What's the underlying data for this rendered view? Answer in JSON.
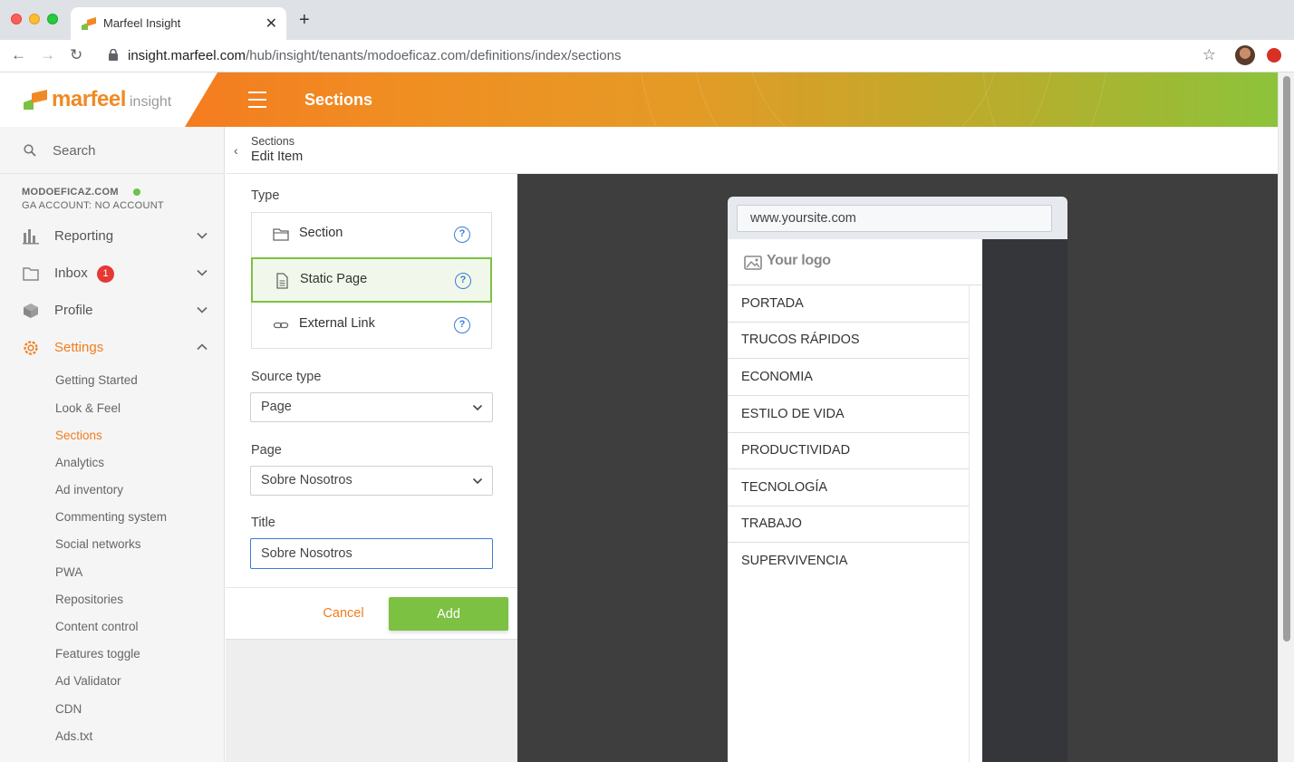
{
  "browser": {
    "tab_title": "Marfeel Insight",
    "url_domain": "insight.marfeel.com",
    "url_path": "/hub/insight/tenants/modoeficaz.com/definitions/index/sections"
  },
  "header": {
    "logo_text": "marfeel",
    "logo_sub": "insight",
    "title": "Sections"
  },
  "sidebar": {
    "search_placeholder": "Search",
    "account_name": "MODOEFICAZ.COM",
    "account_sub": "GA ACCOUNT: NO ACCOUNT",
    "nav": [
      {
        "label": "Reporting",
        "icon": "bar-chart-icon"
      },
      {
        "label": "Inbox",
        "icon": "folder-icon",
        "badge": "1"
      },
      {
        "label": "Profile",
        "icon": "cube-icon"
      },
      {
        "label": "Settings",
        "icon": "gear-icon"
      }
    ],
    "settings_items": [
      "Getting Started",
      "Look & Feel",
      "Sections",
      "Analytics",
      "Ad inventory",
      "Commenting system",
      "Social networks",
      "PWA",
      "Repositories",
      "Content control",
      "Features toggle",
      "Ad Validator",
      "CDN",
      "Ads.txt"
    ],
    "active_item": "Sections"
  },
  "breadcrumb": {
    "parent": "Sections",
    "current": "Edit Item"
  },
  "form": {
    "type_label": "Type",
    "types": [
      {
        "label": "Section",
        "icon": "folder-icon",
        "help": "?"
      },
      {
        "label": "Static Page",
        "icon": "document-icon",
        "help": "?"
      },
      {
        "label": "External Link",
        "icon": "link-icon",
        "help": "?"
      }
    ],
    "selected_type": "Static Page",
    "source_type_label": "Source type",
    "source_type_value": "Page",
    "page_label": "Page",
    "page_value": "Sobre Nosotros",
    "title_label": "Title",
    "title_value": "Sobre Nosotros",
    "cancel_label": "Cancel",
    "add_label": "Add"
  },
  "preview": {
    "url": "www.yoursite.com",
    "logo": "Your logo",
    "menu": [
      "PORTADA",
      "TRUCOS RÁPIDOS",
      "ECONOMIA",
      "ESTILO DE VIDA",
      "PRODUCTIVIDAD",
      "TECNOLOGÍA",
      "TRABAJO",
      "SUPERVIVENCIA"
    ]
  },
  "colors": {
    "brand_orange": "#f07d1e",
    "accent_green": "#7cc142",
    "focus_blue": "#3a7bd5"
  }
}
